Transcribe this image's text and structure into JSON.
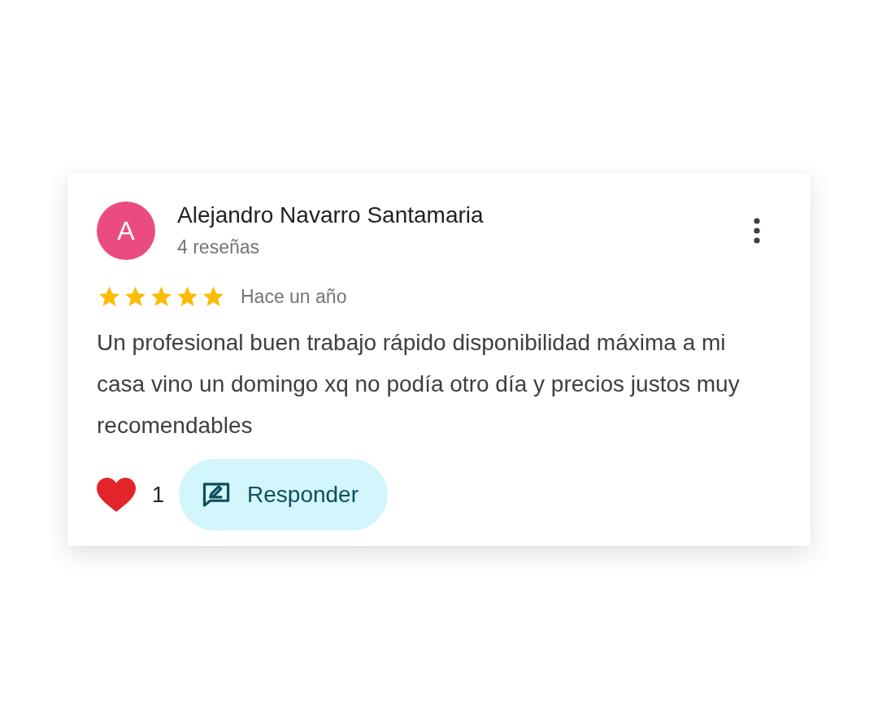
{
  "review": {
    "avatar_letter": "A",
    "author": "Alejandro Navarro Santamaria",
    "review_count": "4 reseñas",
    "stars": 5,
    "time": "Hace un año",
    "text": "Un profesional buen trabajo rápido disponibilidad máxima a mi casa vino un domingo xq no podía otro día y precios justos muy recomendables",
    "likes": "1",
    "reply_button": "Responder"
  }
}
